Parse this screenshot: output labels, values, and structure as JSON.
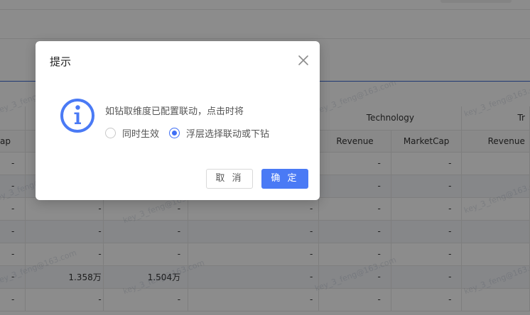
{
  "dialog": {
    "title": "提示",
    "message": "如钻取维度已配置联动，点击时将",
    "options": [
      {
        "label": "同时生效",
        "checked": false
      },
      {
        "label": "浮层选择联动或下钻",
        "checked": true
      }
    ],
    "cancel_label": "取 消",
    "ok_label": "确 定",
    "icon": "info-icon",
    "close_icon": "close-icon"
  },
  "table": {
    "group_headers": [
      "Technology",
      "Tr"
    ],
    "sub_headers": [
      "ap",
      "Revenue",
      "MarketCap",
      "Revenue"
    ],
    "rows": [
      [
        "-",
        "",
        "",
        "",
        "-",
        "-",
        ""
      ],
      [
        "-",
        "",
        "",
        "",
        "-",
        "-",
        ""
      ],
      [
        "-",
        "-",
        "-",
        "-",
        "-",
        "-",
        ""
      ],
      [
        "-",
        "-",
        "-",
        "-",
        "-",
        "-",
        ""
      ],
      [
        "-",
        "-",
        "-",
        "-",
        "-",
        "-",
        ""
      ],
      [
        "-",
        "1.358万",
        "1.504万",
        "-",
        "-",
        "-",
        ""
      ],
      [
        "-",
        "-",
        "-",
        "-",
        "-",
        "-",
        ""
      ]
    ]
  },
  "watermark_text": "key_3_feng@163.com",
  "colors": {
    "primary": "#4a7af5",
    "accent_line": "#3d6bd1",
    "mask": "rgba(0,0,0,0.45)"
  }
}
